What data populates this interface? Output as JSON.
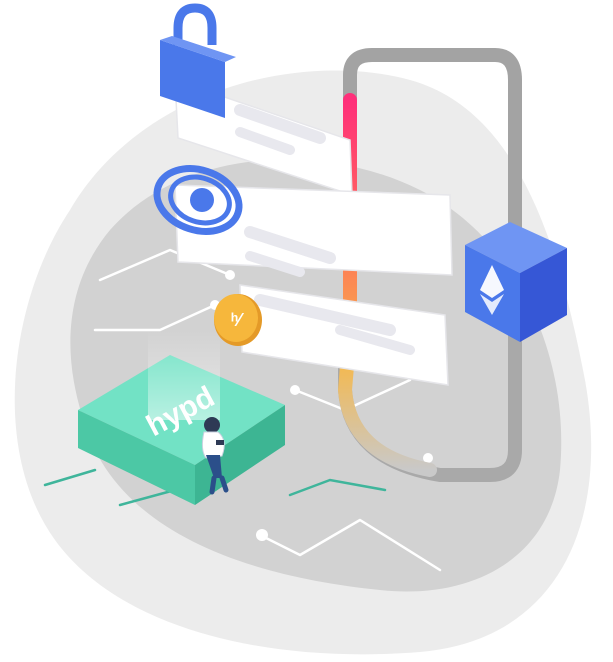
{
  "scene": {
    "chip": {
      "label": "hypd"
    },
    "coin": {
      "glyph": "hypd-logo-icon"
    },
    "cube": {
      "glyph": "ethereum-icon"
    },
    "lock": {
      "icon": "padlock-icon"
    },
    "eye": {
      "icon": "eye-icon"
    }
  },
  "colors": {
    "blob_light": "#ececec",
    "blob_dark": "#cfcfcf",
    "circuit_teal": "#3fb59b",
    "chip_top": "#6fe0c2",
    "chip_side": "#48c6a3",
    "coin": "#f6b73c",
    "cube_top": "#5b86f0",
    "cube_side": "#3c5fe0",
    "lock_blue": "#4a78ea",
    "accent_pink": "#ff2f7a",
    "accent_orange": "#f6a341",
    "rail_gray": "#9c9c9c",
    "card_white": "#ffffff",
    "card_bar": "#e9e9ee"
  }
}
